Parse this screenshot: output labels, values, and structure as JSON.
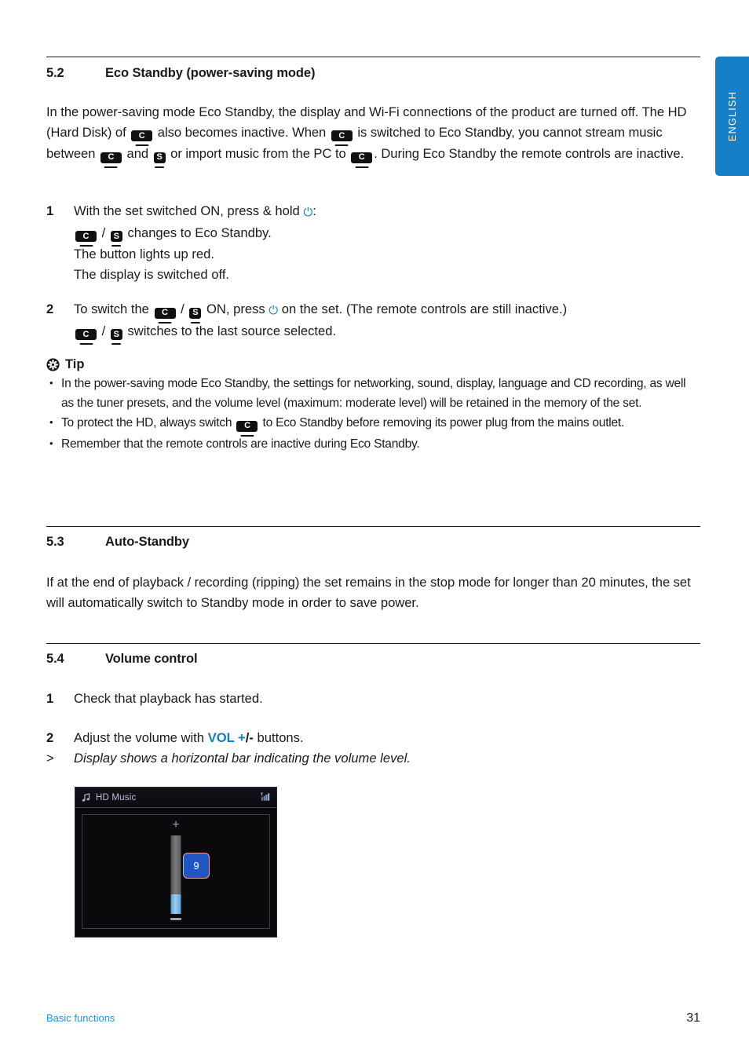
{
  "language_tab": {
    "label": "ENGLISH"
  },
  "sections": {
    "eco_standby": {
      "number": "5.2",
      "title": "Eco Standby (power-saving mode)",
      "intro": {
        "t1": "In the power-saving mode Eco Standby, the display and Wi-Fi connections of the product are turned off. The HD (Hard Disk) of ",
        "t2": " also becomes inactive. When ",
        "t3": " is switched to Eco Standby, you cannot stream music between ",
        "t4": " and ",
        "t5": " or import music from the PC to ",
        "t6": ". During Eco Standby the remote controls are inactive."
      },
      "steps": [
        {
          "num": "1",
          "line1_a": "With the set switched ON, press & hold ",
          "line1_b": ":",
          "line2_a": " / ",
          "line2_b": " changes to Eco Standby.",
          "line3": "The button lights up red.",
          "line4": "The display is switched off."
        },
        {
          "num": "2",
          "line1_a": "To switch the ",
          "line1_b": " / ",
          "line1_c": " ON, press ",
          "line1_d": " on the set. (The remote controls are still inactive.)",
          "line2_a": " / ",
          "line2_b": " switches to the last source selected."
        }
      ],
      "tip": {
        "heading": "Tip",
        "bullets": [
          {
            "text": "In the power-saving mode Eco Standby, the settings for networking, sound, display, language and CD recording, as well as the tuner presets, and the volume level (maximum: moderate level) will be retained in the memory of the set."
          },
          {
            "text_a": "To protect the HD, always switch ",
            "text_b": " to Eco Standby before removing its power plug from the mains outlet."
          },
          {
            "text": "Remember that the remote controls are inactive during Eco Standby."
          }
        ]
      }
    },
    "auto_standby": {
      "number": "5.3",
      "title": "Auto-Standby",
      "body": "If at the end of playback / recording (ripping) the set remains in the stop mode for longer than 20 minutes, the set will automatically switch to Standby mode in order to save power."
    },
    "volume_control": {
      "number": "5.4",
      "title": "Volume control",
      "steps": [
        {
          "num": "1",
          "text": "Check that playback has started."
        },
        {
          "num": "2",
          "text_a": "Adjust the volume with ",
          "accent_blue": "VOL +",
          "accent_black": "/-",
          "text_b": " buttons."
        },
        {
          "num": ">",
          "text": "Display shows a horizontal bar indicating the volume level."
        }
      ],
      "display": {
        "title": "HD Music",
        "plus": "+",
        "volume_value": "9",
        "slider_fill_percent": 25
      }
    }
  },
  "badges": {
    "center": "C",
    "station": "S"
  },
  "icons": {
    "power": "⏻"
  },
  "footer": {
    "section_name": "Basic functions",
    "page_number": "31"
  },
  "colors": {
    "accent_blue": "#1580c8",
    "link_blue": "#2f8fd4",
    "vol_badge_blue": "#1f56c4",
    "display_bg": "#0a0a0c"
  }
}
